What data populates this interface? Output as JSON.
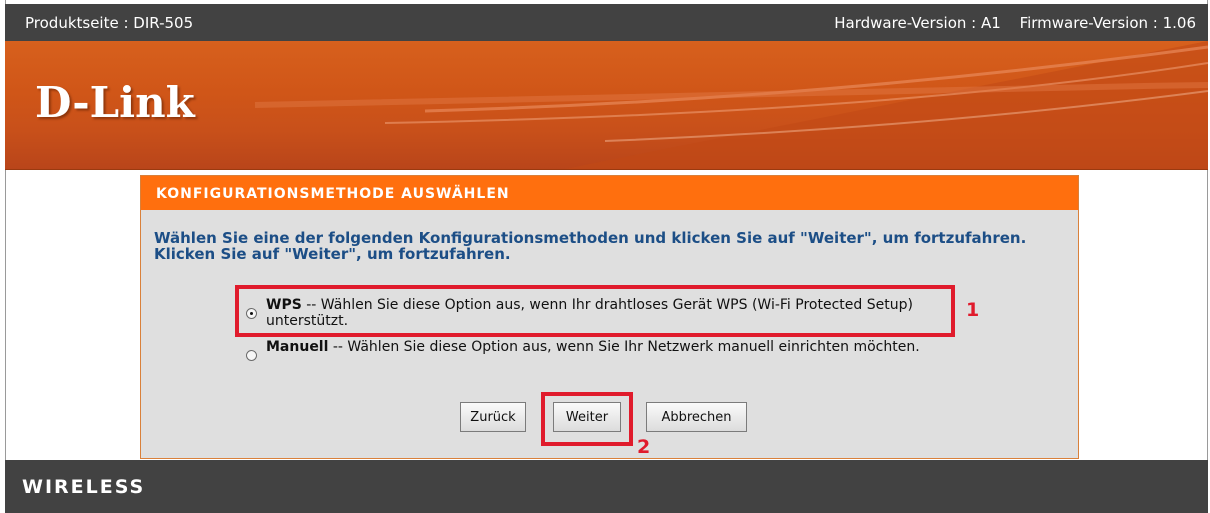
{
  "top_bar": {
    "product": "Produktseite : DIR-505",
    "hardware": "Hardware-Version : A1",
    "firmware": "Firmware-Version : 1.06"
  },
  "banner": {
    "logo": "D-Link"
  },
  "section": {
    "title": "KONFIGURATIONSMETHODE AUSWÄHLEN",
    "intro": "Wählen Sie eine der folgenden Konfigurationsmethoden und klicken Sie auf \"Weiter\", um fortzufahren. Klicken Sie auf \"Weiter\", um fortzufahren."
  },
  "options": [
    {
      "name": "WPS",
      "description": " -- Wählen Sie diese Option aus, wenn Ihr drahtloses Gerät WPS (Wi-Fi Protected Setup) unterstützt.",
      "selected": true
    },
    {
      "name": "Manuell",
      "description": " -- Wählen Sie diese Option aus, wenn Sie Ihr Netzwerk manuell einrichten möchten.",
      "selected": false
    }
  ],
  "buttons": {
    "back": "Zurück",
    "next": "Weiter",
    "cancel": "Abbrechen"
  },
  "annotations": {
    "marker_1": "1",
    "marker_2": "2",
    "color": "#e01b2c"
  },
  "footer": {
    "label": "WIRELESS"
  },
  "colors": {
    "top_bar": "#424242",
    "banner": "#d05618",
    "header_orange": "#ff6f0e",
    "panel_bg": "#dfdfdf",
    "intro_text": "#1c4e86"
  }
}
